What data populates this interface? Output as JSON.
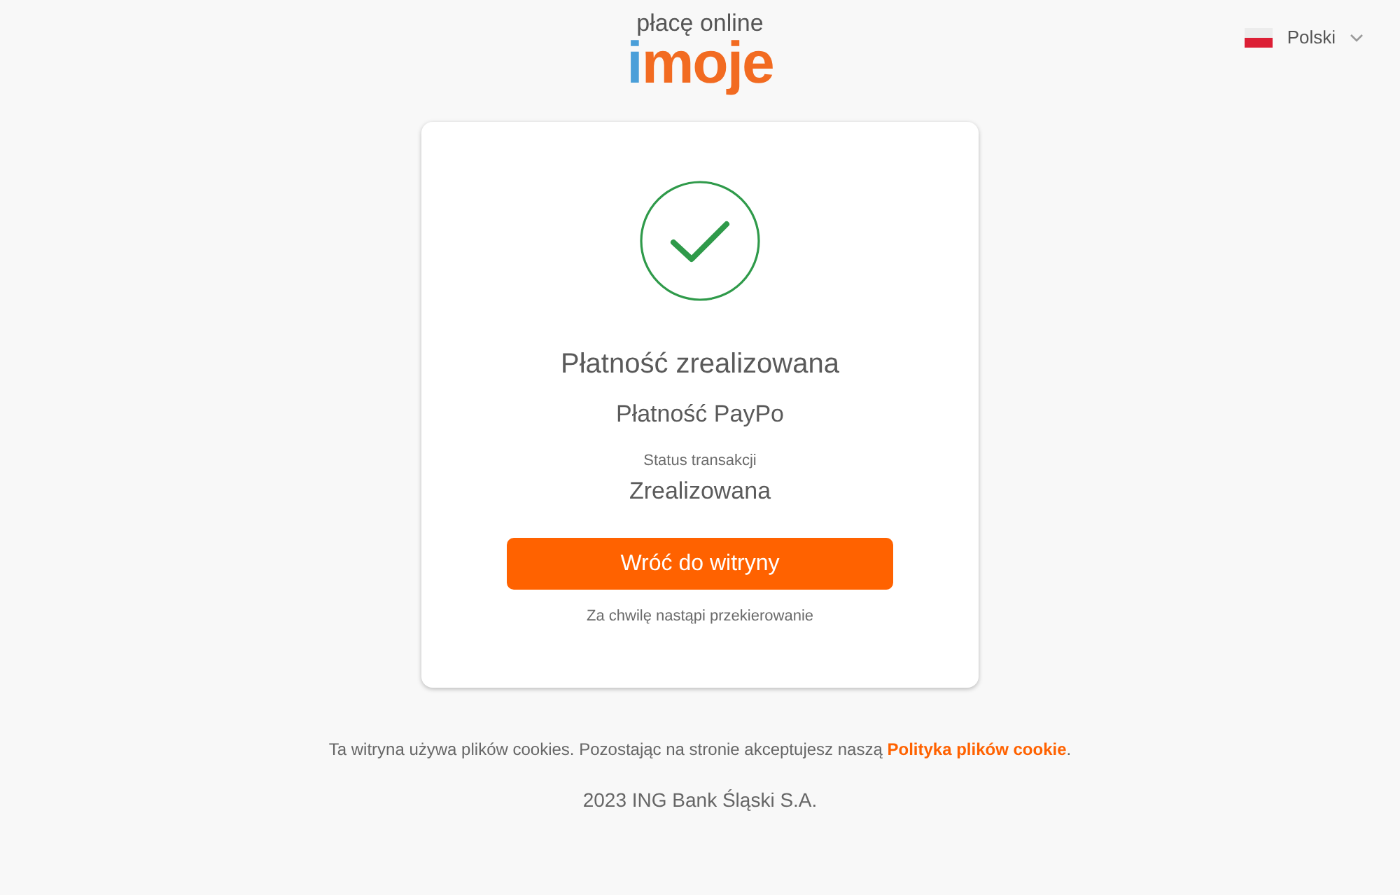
{
  "header": {
    "logo": {
      "tagline": "płacę online",
      "wordmark": [
        {
          "text": "i",
          "color": "#4a9fd9"
        },
        {
          "text": "moje",
          "color": "#f26b21"
        }
      ]
    },
    "language": {
      "label": "Polski"
    }
  },
  "card": {
    "title": "Płatność zrealizowana",
    "payment_method": "Płatność PayPo",
    "status_label": "Status transakcji",
    "status_value": "Zrealizowana",
    "button": "Wróć do witryny",
    "redirect_note": "Za chwilę nastąpi przekierowanie"
  },
  "footer": {
    "cookie_notice": {
      "text": "Ta witryna używa plików cookies. Pozostając na stronie akceptujesz naszą",
      "link": "Polityka plików cookie",
      "suffix": "."
    },
    "copyright": "2023 ING Bank Śląski S.A."
  }
}
